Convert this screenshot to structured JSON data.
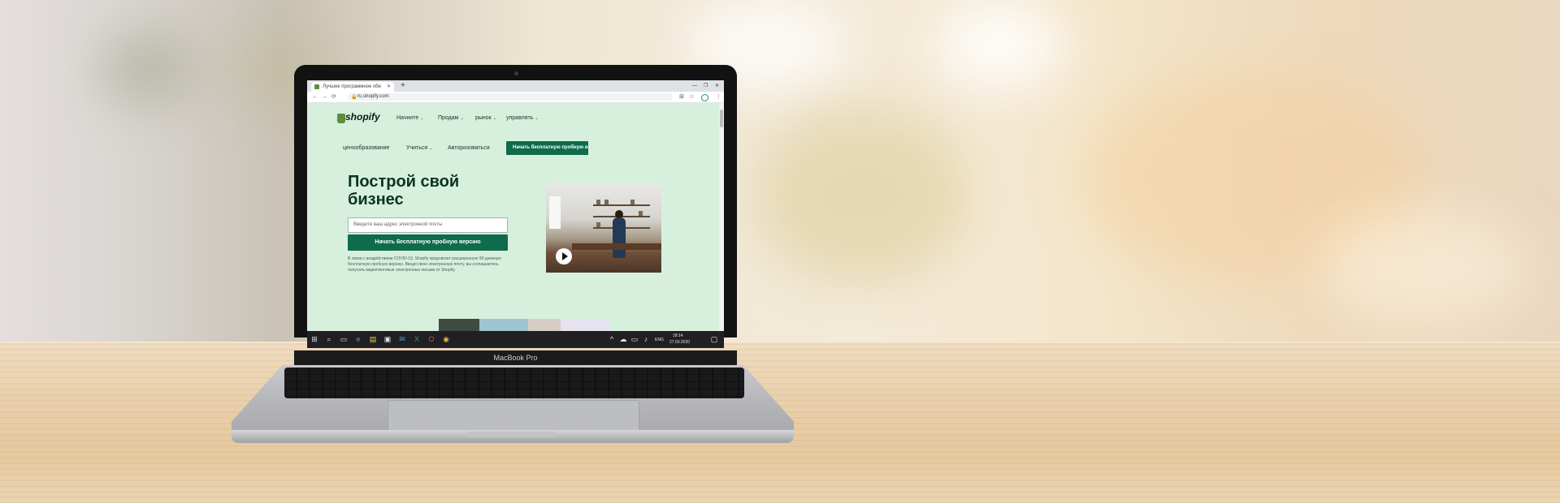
{
  "laptop": {
    "model_name": "MacBook Pro"
  },
  "browser": {
    "tab_title": "Лучшее программное обеспе...",
    "tab_close": "✕",
    "new_tab": "+",
    "window_controls": {
      "minimize": "—",
      "maximize": "❐",
      "close": "✕"
    },
    "nav": {
      "back": "←",
      "forward": "→",
      "reload": "⟳"
    },
    "url": "ru.shopify.com",
    "lock": "🔒",
    "ext_icons": {
      "translate": "⊞",
      "star": "☆",
      "menu": "⋮"
    }
  },
  "shopify": {
    "logo_text": "shopify",
    "nav_top": [
      {
        "label": "Начните"
      },
      {
        "label": "Продам"
      },
      {
        "label": "рынок"
      },
      {
        "label": "управлять"
      }
    ],
    "chevron": "⌄",
    "nav_secondary": {
      "pricing": "ценообразование",
      "learn": "Учиться",
      "login": "Авторизоваться",
      "cta": "Начать бесплатную пробную ве"
    },
    "hero_title": "Построй свой бизнес",
    "email_placeholder": "Введите ваш адрес электронной почты",
    "cta_big": "Начать бесплатную пробную версию",
    "disclaimer": "В связи с воздействием COVID-19, Shopify предлагает расширенную 90 дневную бесплатную пробную версию. Вводя свою электронную почту, вы соглашаетесь получать маркетинговые электронные письма от Shopify."
  },
  "taskbar": {
    "language": "ENG",
    "time": "18:14",
    "date": "27.03.2020"
  },
  "colors": {
    "page_bg": "#d7f0de",
    "brand_green": "#0e6b4b",
    "logo_green": "#5e8e3e"
  }
}
